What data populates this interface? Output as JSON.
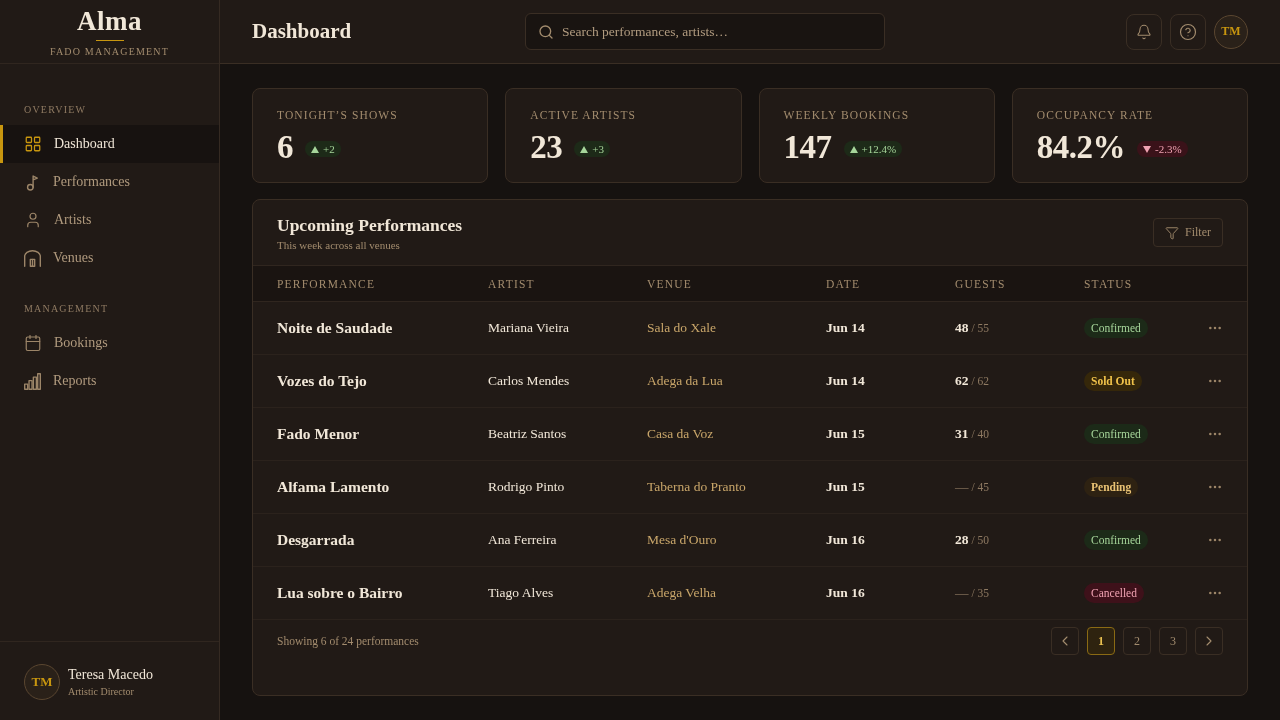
{
  "sidebar": {
    "brand": {
      "name": "Alma",
      "tagline": "FADO MANAGEMENT"
    },
    "sections": [
      {
        "title": "OVERVIEW",
        "items": [
          {
            "label": "Dashboard",
            "kind": "grid",
            "selected": true
          },
          {
            "label": "Performances",
            "kind": "note",
            "selected": false
          },
          {
            "label": "Artists",
            "kind": "person",
            "selected": false
          },
          {
            "label": "Venues",
            "kind": "venue",
            "selected": false
          }
        ]
      },
      {
        "title": "MANAGEMENT",
        "items": [
          {
            "label": "Bookings",
            "kind": "calendar",
            "selected": false
          },
          {
            "label": "Reports",
            "kind": "bars",
            "selected": false
          }
        ]
      }
    ],
    "user": {
      "initials": "TM",
      "name": "Teresa Macedo",
      "role": "Artistic Director"
    }
  },
  "header": {
    "title": "Dashboard",
    "search": {
      "placeholder": "Search performances, artists…"
    },
    "avatar": "TM"
  },
  "stats": [
    {
      "label": "TONIGHT’S SHOWS",
      "value": "6",
      "change": "+2",
      "kind": "up"
    },
    {
      "label": "ACTIVE ARTISTS",
      "value": "23",
      "change": "+3",
      "kind": "up"
    },
    {
      "label": "WEEKLY BOOKINGS",
      "value": "147",
      "change": "+12.4%",
      "kind": "up"
    },
    {
      "label": "OCCUPANCY RATE",
      "value": "84.2%",
      "change": "-2.3%",
      "kind": "down"
    }
  ],
  "table": {
    "title": "Upcoming Performances",
    "subtitle": "This week across all venues",
    "filter": "Filter",
    "columns": [
      "PERFORMANCE",
      "ARTIST",
      "VENUE",
      "DATE",
      "GUESTS",
      "STATUS"
    ],
    "rows": [
      {
        "performance": "Noite de Saudade",
        "artist": "Mariana Vieira",
        "venue": "Sala do Xale",
        "date": "Jun 14",
        "guests": "48",
        "capacity": "/ 55",
        "status": "Confirmed",
        "kind": "confirmed"
      },
      {
        "performance": "Vozes do Tejo",
        "artist": "Carlos Mendes",
        "venue": "Adega da Lua",
        "date": "Jun 14",
        "guests": "62",
        "capacity": "/ 62",
        "status": "Sold Out",
        "kind": "soldout"
      },
      {
        "performance": "Fado Menor",
        "artist": "Beatriz Santos",
        "venue": "Casa da Voz",
        "date": "Jun 15",
        "guests": "31",
        "capacity": "/ 40",
        "status": "Confirmed",
        "kind": "confirmed"
      },
      {
        "performance": "Alfama Lamento",
        "artist": "Rodrigo Pinto",
        "venue": "Taberna do Pranto",
        "date": "Jun 15",
        "guests": "—",
        "capacity": "/ 45",
        "status": "Pending",
        "kind": "pending"
      },
      {
        "performance": "Desgarrada",
        "artist": "Ana Ferreira",
        "venue": "Mesa d'Ouro",
        "date": "Jun 16",
        "guests": "28",
        "capacity": "/ 50",
        "status": "Confirmed",
        "kind": "confirmed"
      },
      {
        "performance": "Lua sobre o Bairro",
        "artist": "Tiago Alves",
        "venue": "Adega Velha",
        "date": "Jun 16",
        "guests": "—",
        "capacity": "/ 35",
        "status": "Cancelled",
        "kind": "cancelled"
      }
    ]
  },
  "pagination": {
    "summary": "Showing 6 of 24 performances",
    "pages": [
      {
        "label": "1",
        "selected": true
      },
      {
        "label": "2",
        "selected": false
      },
      {
        "label": "3",
        "selected": false
      }
    ]
  }
}
